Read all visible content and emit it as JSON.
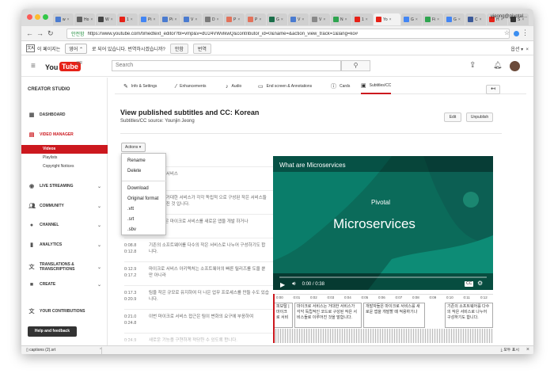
{
  "browser": {
    "tabs": [
      {
        "label": "w",
        "color": "#4a7bd0"
      },
      {
        "label": "Ho",
        "color": "#5e5e5e"
      },
      {
        "label": "W",
        "color": "#444444"
      },
      {
        "label": "1",
        "color": "#e62117"
      },
      {
        "label": "Pi",
        "color": "#4285f4"
      },
      {
        "label": "Pi",
        "color": "#4a7bd0"
      },
      {
        "label": "V",
        "color": "#4a7bd0"
      },
      {
        "label": "D",
        "color": "#7a7a7a"
      },
      {
        "label": "P",
        "color": "#e2725b"
      },
      {
        "label": "P",
        "color": "#e2725b"
      },
      {
        "label": "G",
        "color": "#1a6e4a"
      },
      {
        "label": "V",
        "color": "#4a7bd0"
      },
      {
        "label": "V",
        "color": "#888888"
      },
      {
        "label": "N",
        "color": "#2ea44f"
      },
      {
        "label": "1",
        "color": "#e62117"
      },
      {
        "label": "Yo",
        "color": "#e62117",
        "active": true
      },
      {
        "label": "G",
        "color": "#4285f4"
      },
      {
        "label": "Fi",
        "color": "#2ea44f"
      },
      {
        "label": "G",
        "color": "#4285f4"
      },
      {
        "label": "C",
        "color": "#3b5998"
      },
      {
        "label": "H",
        "color": "#e62117"
      },
      {
        "label": "S",
        "color": "#333333"
      }
    ],
    "profile_name": "yjeong@pivotal...",
    "secure_label": "안전함",
    "url": "https://www.youtube.com/timedtext_editor?bl=vmp&lang=en&v=dU24VWvlkwQ&contributor_id=0&name=&action_view_track=1&lang=ko#",
    "url_prefix": "https://",
    "url_rest": "www.youtube.com/timedtext_editor?bl=vmp&v=dU24VWvlkwQ&contributor_id=0&name=&action_view_track=1&lang=ko#"
  },
  "translate": {
    "page_is_in": "이 페이지는",
    "language": "영어",
    "prompt": "로 되어 있습니다. 번역하시겠습니까?",
    "translate_btn": "번역",
    "original_btn": "안함",
    "options": "옵션"
  },
  "header": {
    "logo_you": "You",
    "logo_tube": "Tube",
    "region": "KR",
    "search_placeholder": "Search"
  },
  "sidebar": {
    "title": "CREATOR STUDIO",
    "dashboard": "DASHBOARD",
    "video_manager": "VIDEO MANAGER",
    "sub_items": [
      "Videos",
      "Playlists",
      "Copyright Notices"
    ],
    "live_streaming": "LIVE STREAMING",
    "community": "COMMUNITY",
    "channel": "CHANNEL",
    "analytics": "ANALYTICS",
    "translations_1": "TRANSLATIONS &",
    "translations_2": "TRANSCRIPTIONS",
    "create": "CREATE",
    "your_contributions": "YOUR CONTRIBUTIONS",
    "help": "Help and feedback"
  },
  "editor_tabs": [
    "Info & Settings",
    "Enhancements",
    "Audio",
    "End screen & Annotations",
    "Cards",
    "Subtitles/CC"
  ],
  "page": {
    "title": "View published subtitles and CC: Korean",
    "subtitle_source": "Subtitles/CC source: Younjin Jeong",
    "edit_btn": "Edit",
    "unpublish_btn": "Unpublish",
    "actions_btn": "Actions"
  },
  "actions_menu": {
    "items": [
      "Rename",
      "Delete"
    ],
    "download": "Download",
    "formats": [
      "Original format",
      ".vtt",
      ".srt",
      ".sbv"
    ]
  },
  "subtitle_rows": [
    {
      "start": "",
      "end": "",
      "text": "마이크로 서비스"
    },
    {
      "start": "",
      "end": "",
      "text": "서비스는 거대한 서비스가 각각 독립적 으로 구성된 작은 서비스들로 이루어진 것 입니다."
    },
    {
      "start": "",
      "end": "",
      "text": "개발자들은 마이크로 서비스를 새로운 앱을 개발 하거나"
    },
    {
      "start": "0:08.8",
      "end": "0:12.8",
      "text": "기존의 소프트웨어를 다수의 작은 서비스로 나누어 구성하기도 합니다."
    },
    {
      "start": "0:12.9",
      "end": "0:17.2",
      "text": "마이크로 서비스 아키텍처는 소프트웨어의 빠른 릴리즈를 도울 뿐만 아니라"
    },
    {
      "start": "0:17.3",
      "end": "0:20.9",
      "text": "팀을 작은 규모로 유지하여 더 나은 업무 프로세스를 만들 수도 있습니다."
    },
    {
      "start": "0:21.0",
      "end": "0:24.8",
      "text": "이번 마이크로 서비스 접근은 팀이 변화의 요구에 부응하여"
    },
    {
      "start": "0:24.9",
      "end": "",
      "text": "새로운 기능을 구현하게 적당한 수 있도록 합니다."
    }
  ],
  "player": {
    "video_title": "What are Microservices",
    "brand": "Pivotal",
    "headline": "Microservices",
    "time": "0:00 / 0:38",
    "cc_label": "CC"
  },
  "timeline": {
    "ticks": [
      "0:00",
      "0:01",
      "0:02",
      "0:03",
      "0:04",
      "0:05",
      "0:06",
      "0:07",
      "0:08",
      "0:09",
      "0:10",
      "0:11",
      "0:12"
    ],
    "cues": [
      "피보탈 | 마이크로 서비",
      "마이크로 서비스는 거대한 서비스가 각각 독립적인 코드로 구성된 작은 서비스들로 이루어진 것을 말합니다.",
      "개발자들은 마이크로 서비스를 새로운 앱을 개발할 때 적용하기나",
      "기존의 소프트웨어를 다수의 작은 서비스로 나누어 구성하기도 합니다."
    ]
  },
  "downloads": {
    "file": "captions (2).srt",
    "show_all": "모두 표시"
  },
  "colors": {
    "youtube_red": "#e62117",
    "studio_red": "#cc181e",
    "video_teal": "#0b6b5a"
  }
}
